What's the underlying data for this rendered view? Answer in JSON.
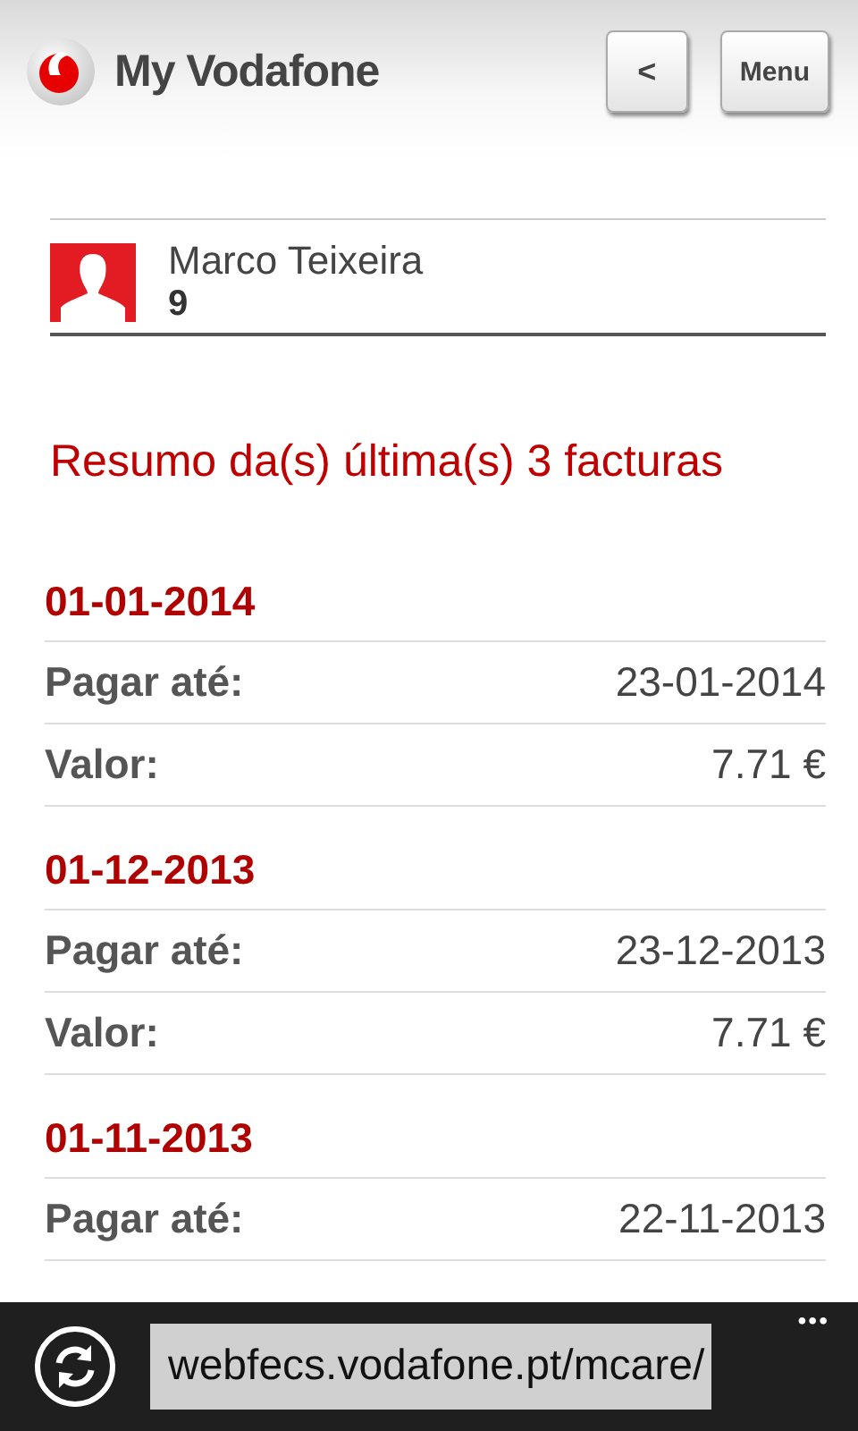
{
  "header": {
    "title": "My Vodafone",
    "back_button": "<",
    "menu_button": "Menu"
  },
  "profile": {
    "name": "Marco Teixeira",
    "number": "9"
  },
  "summary_title": "Resumo da(s) última(s) 3 facturas",
  "invoices": [
    {
      "date": "01-01-2014",
      "rows": [
        {
          "label": "Pagar até:",
          "value": "23-01-2014"
        },
        {
          "label": "Valor:",
          "value": "7.71 €"
        }
      ]
    },
    {
      "date": "01-12-2013",
      "rows": [
        {
          "label": "Pagar até:",
          "value": "23-12-2013"
        },
        {
          "label": "Valor:",
          "value": "7.71 €"
        }
      ]
    },
    {
      "date": "01-11-2013",
      "rows": [
        {
          "label": "Pagar até:",
          "value": "22-11-2013"
        }
      ]
    }
  ],
  "browser_bar": {
    "url": "webfecs.vodafone.pt/mcare/",
    "more": "•••"
  }
}
